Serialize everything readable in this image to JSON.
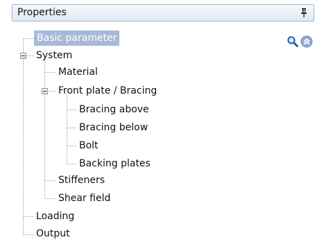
{
  "panel": {
    "title": "Properties",
    "pin_icon": "pin-icon",
    "toolbar_icons": [
      "search-icon",
      "collapse-up-icon"
    ]
  },
  "tree": {
    "selected": "Basic parameter",
    "items": [
      {
        "label": "Basic parameter",
        "level": 0,
        "selected": true
      },
      {
        "label": "System",
        "level": 0,
        "expanded": true
      },
      {
        "label": "Material",
        "level": 1
      },
      {
        "label": "Front plate / Bracing",
        "level": 1,
        "expanded": true
      },
      {
        "label": "Bracing above",
        "level": 2
      },
      {
        "label": "Bracing below",
        "level": 2
      },
      {
        "label": "Bolt",
        "level": 2
      },
      {
        "label": "Backing plates",
        "level": 2
      },
      {
        "label": "Stiffeners",
        "level": 1
      },
      {
        "label": "Shear field",
        "level": 1
      },
      {
        "label": "Loading",
        "level": 0
      },
      {
        "label": "Output",
        "level": 0
      }
    ]
  },
  "colors": {
    "selection": "#a6b9d8",
    "header_border": "#9fb6d3",
    "tree_lines": "#a0a0a0"
  }
}
